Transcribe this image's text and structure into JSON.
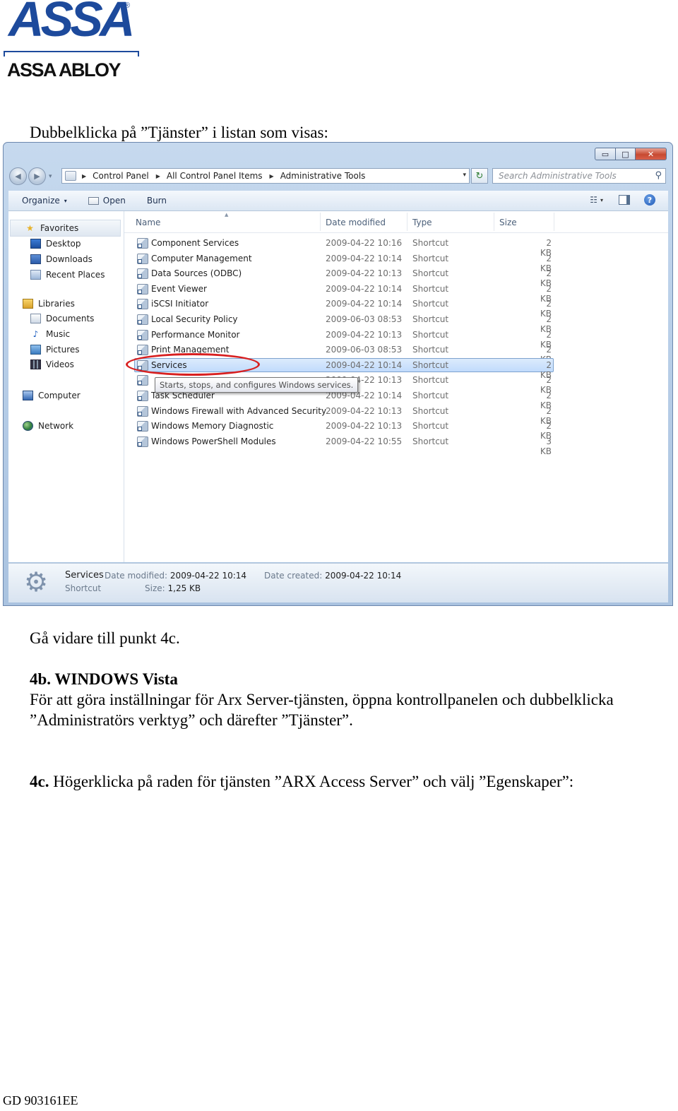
{
  "logo": {
    "top": "ASSA",
    "registered": "®",
    "bottom": "ASSA ABLOY"
  },
  "doc": {
    "instruction_1": "Dubbelklicka på ”Tjänster” i listan som visas:",
    "instruction_2": "Gå vidare till punkt 4c.",
    "heading_4b": "4b. WINDOWS Vista",
    "para_4b_line1": "För att göra inställningar för Arx Server-tjänsten, öppna kontrollpanelen och dubbelklicka",
    "para_4b_line2": "”Administratörs verktyg” och därefter ”Tjänster”.",
    "heading_4c_prefix": "4c.",
    "heading_4c_text": " Högerklicka på raden för tjänsten ”ARX Access Server” och välj ”Egenskaper”:",
    "footer": "GD 903161EE"
  },
  "window": {
    "caption_buttons": {
      "minimize": "▭",
      "maximize": "□",
      "close": "✕"
    },
    "nav": {
      "back": "◀",
      "forward": "▶",
      "dropdown": "▾"
    },
    "address": {
      "crumbs": [
        "Control Panel",
        "All Control Panel Items",
        "Administrative Tools"
      ],
      "separator": "▶",
      "dropdown": "▾"
    },
    "refresh": "↻",
    "search": {
      "placeholder": "Search Administrative Tools",
      "icon": "⚲"
    },
    "toolbar": {
      "organize": "Organize",
      "organize_dd": "▾",
      "open": "Open",
      "burn": "Burn",
      "views_icon": "☷",
      "views_dd": "▾",
      "help": "?"
    },
    "nav_pane": {
      "favorites": {
        "label": "Favorites",
        "items": [
          "Desktop",
          "Downloads",
          "Recent Places"
        ]
      },
      "libraries": {
        "label": "Libraries",
        "items": [
          "Documents",
          "Music",
          "Pictures",
          "Videos"
        ]
      },
      "computer": "Computer",
      "network": "Network",
      "icons": {
        "star": "★",
        "music": "♪"
      }
    },
    "columns": {
      "name": "Name",
      "date": "Date modified",
      "type": "Type",
      "size": "Size",
      "sort_caret": "▲"
    },
    "files": [
      {
        "name": "Component Services",
        "date": "2009-04-22 10:16",
        "type": "Shortcut",
        "size": "2 KB"
      },
      {
        "name": "Computer Management",
        "date": "2009-04-22 10:14",
        "type": "Shortcut",
        "size": "2 KB"
      },
      {
        "name": "Data Sources (ODBC)",
        "date": "2009-04-22 10:13",
        "type": "Shortcut",
        "size": "2 KB"
      },
      {
        "name": "Event Viewer",
        "date": "2009-04-22 10:14",
        "type": "Shortcut",
        "size": "2 KB"
      },
      {
        "name": "iSCSI Initiator",
        "date": "2009-04-22 10:14",
        "type": "Shortcut",
        "size": "2 KB"
      },
      {
        "name": "Local Security Policy",
        "date": "2009-06-03 08:53",
        "type": "Shortcut",
        "size": "2 KB"
      },
      {
        "name": "Performance Monitor",
        "date": "2009-04-22 10:13",
        "type": "Shortcut",
        "size": "2 KB"
      },
      {
        "name": "Print Management",
        "date": "2009-06-03 08:53",
        "type": "Shortcut",
        "size": "2 KB"
      },
      {
        "name": "Services",
        "date": "2009-04-22 10:14",
        "type": "Shortcut",
        "size": "2 KB"
      },
      {
        "name": "",
        "date": "2009-04-22 10:13",
        "type": "Shortcut",
        "size": "2 KB"
      },
      {
        "name": "Task Scheduler",
        "date": "2009-04-22 10:14",
        "type": "Shortcut",
        "size": "2 KB"
      },
      {
        "name": "Windows Firewall with Advanced Security",
        "date": "2009-04-22 10:13",
        "type": "Shortcut",
        "size": "2 KB"
      },
      {
        "name": "Windows Memory Diagnostic",
        "date": "2009-04-22 10:13",
        "type": "Shortcut",
        "size": "2 KB"
      },
      {
        "name": "Windows PowerShell Modules",
        "date": "2009-04-22 10:55",
        "type": "Shortcut",
        "size": "3 KB"
      }
    ],
    "selected_index": 8,
    "tooltip": "Starts, stops, and configures Windows services.",
    "details": {
      "gear_icon": "⚙",
      "name": "Services",
      "type": "Shortcut",
      "modified_label": "Date modified:",
      "modified_value": "2009-04-22 10:14",
      "size_label": "Size:",
      "size_value": "1,25 KB",
      "created_label": "Date created:",
      "created_value": "2009-04-22 10:14"
    }
  }
}
